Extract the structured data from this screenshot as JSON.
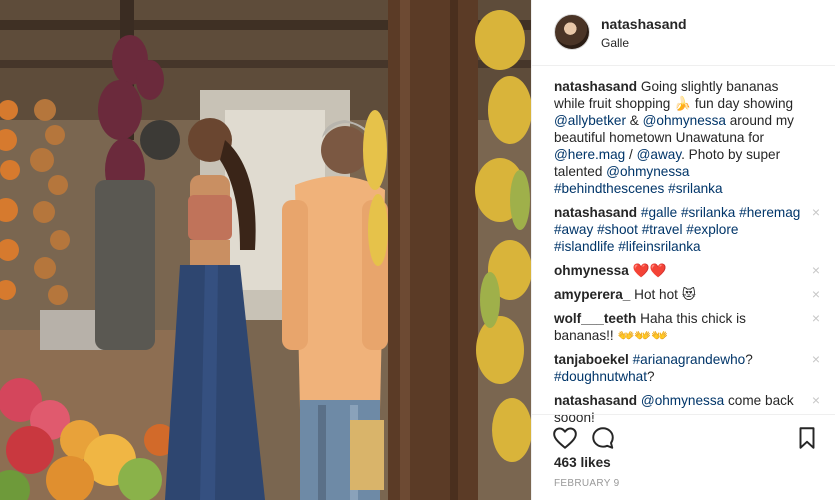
{
  "post": {
    "author": "natashasand",
    "location": "Galle",
    "likes": "463 likes",
    "date": "FEBRUARY 9"
  },
  "caption": {
    "user": "natashasand",
    "parts": [
      {
        "text": "Going slightly bananas while fruit shopping 🍌 fun day showing ",
        "kind": "text"
      },
      {
        "text": "@allybetker",
        "kind": "tag"
      },
      {
        "text": " & ",
        "kind": "text"
      },
      {
        "text": "@ohmynessa",
        "kind": "tag"
      },
      {
        "text": " around my beautiful hometown Unawatuna for ",
        "kind": "text"
      },
      {
        "text": "@here.mag",
        "kind": "tag"
      },
      {
        "text": " / ",
        "kind": "text"
      },
      {
        "text": "@away",
        "kind": "tag"
      },
      {
        "text": ". Photo by super talented ",
        "kind": "text"
      },
      {
        "text": "@ohmynessa",
        "kind": "tag"
      },
      {
        "text": " ",
        "kind": "text"
      },
      {
        "text": "#behindthescenes",
        "kind": "tag"
      },
      {
        "text": " ",
        "kind": "text"
      },
      {
        "text": "#srilanka",
        "kind": "tag"
      }
    ]
  },
  "comments": [
    {
      "user": "natashasand",
      "parts": [
        {
          "text": "#galle",
          "kind": "tag"
        },
        {
          "text": " ",
          "kind": "text"
        },
        {
          "text": "#srilanka",
          "kind": "tag"
        },
        {
          "text": " ",
          "kind": "text"
        },
        {
          "text": "#heremag",
          "kind": "tag"
        },
        {
          "text": " ",
          "kind": "text"
        },
        {
          "text": "#away",
          "kind": "tag"
        },
        {
          "text": " ",
          "kind": "text"
        },
        {
          "text": "#shoot",
          "kind": "tag"
        },
        {
          "text": " ",
          "kind": "text"
        },
        {
          "text": "#travel",
          "kind": "tag"
        },
        {
          "text": " ",
          "kind": "text"
        },
        {
          "text": "#explore",
          "kind": "tag"
        },
        {
          "text": " ",
          "kind": "text"
        },
        {
          "text": "#islandlife",
          "kind": "tag"
        },
        {
          "text": " ",
          "kind": "text"
        },
        {
          "text": "#lifeinsrilanka",
          "kind": "tag"
        }
      ]
    },
    {
      "user": "ohmynessa",
      "parts": [
        {
          "text": "❤️❤️",
          "kind": "text"
        }
      ]
    },
    {
      "user": "amyperera_",
      "parts": [
        {
          "text": "Hot hot 😻",
          "kind": "text"
        }
      ]
    },
    {
      "user": "wolf___teeth",
      "parts": [
        {
          "text": "Haha this chick is bananas!! 👐👐👐",
          "kind": "text"
        }
      ]
    },
    {
      "user": "tanjaboekel",
      "parts": [
        {
          "text": "#arianagrandewho",
          "kind": "tag"
        },
        {
          "text": "? ",
          "kind": "text"
        },
        {
          "text": "#doughnutwhat",
          "kind": "tag"
        },
        {
          "text": "?",
          "kind": "text"
        }
      ]
    },
    {
      "user": "natashasand",
      "parts": [
        {
          "text": "@ohmynessa",
          "kind": "tag"
        },
        {
          "text": " come back sooon!",
          "kind": "text"
        }
      ]
    }
  ],
  "remove_glyph": "×",
  "icons": {
    "like": "heart-icon",
    "comment": "comment-icon",
    "save": "bookmark-icon",
    "remove": "close-icon"
  },
  "colors": {
    "text": "#262626",
    "link": "#003569",
    "muted": "#999999",
    "divider": "#efefef"
  }
}
